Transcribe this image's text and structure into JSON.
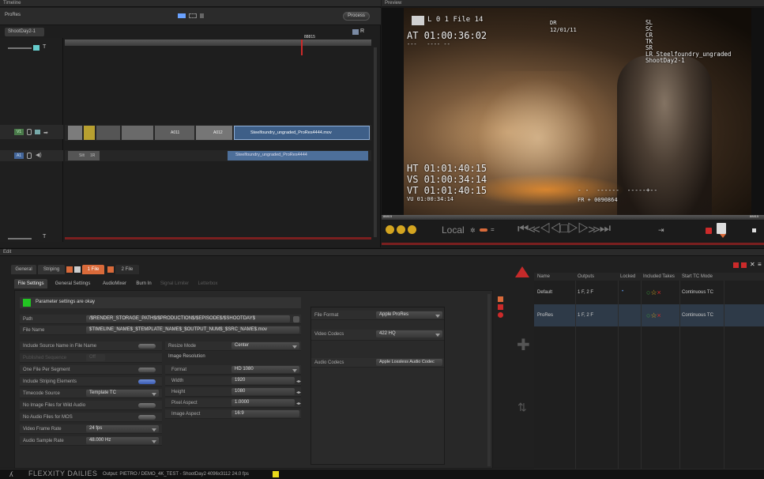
{
  "timeline": {
    "panel_title": "Timeline",
    "project_label": "ProRes",
    "process_button": "Process",
    "sequence_tab": "ShootDay2-1",
    "timecode_marker": "88815",
    "track_video_label": "V1",
    "track_audio_label": "A1",
    "clip_label_1": "A011",
    "clip_label_2": "A012",
    "clip_main": "Steelfoundry_ungraded_ProRes4444.mov",
    "audio_clip": "Steelfoundry_ungraded_ProRes4444",
    "audio_small_1": "Silt",
    "audio_small_2": "1R",
    "track_label_t": "T",
    "track_label_r": "R"
  },
  "preview": {
    "panel_title": "Preview",
    "burn_tl_label": "L 0 1 File 14",
    "burn_at": "AT 01:00:36:02",
    "burn_at_sub": "---   ---- --",
    "burn_dr": "DR",
    "burn_date": "12/01/11",
    "burn_right": "SL\nSC\nCR\nTK\nSR\nLR Steelfoundry_ungraded\nShootDay2-1",
    "burn_ht": "HT 01:01:40:15",
    "burn_vs": "VS 01:00:34:14",
    "burn_vt": "VT 01:01:40:15",
    "burn_vu": "VU 01:00:34:14",
    "burn_dashes": "- -  ------  -----+--",
    "burn_fr": "FR + 0090864",
    "ruler_left": "88815",
    "ruler_right": "88815",
    "local_label": "Local"
  },
  "edit": {
    "panel_title": "Edit",
    "top_tabs": [
      "General",
      "Striping",
      "1 File",
      "2 File"
    ],
    "sub_tabs": [
      "File Settings",
      "General Settings",
      "AudioMixer",
      "Burn In",
      "Signal Limiter",
      "Letterbox"
    ],
    "status_text": "Parameter settings are okay",
    "path_label": "Path",
    "path_value": "/$RENDER_STORAGE_PATH$/$PRODUCTION$/$EPISODE$/$SHOOTDAY$",
    "filename_label": "File Name",
    "filename_value": "$TIMELINE_NAME$_$TEMPLATE_NAME$_$OUTPUT_NUM$_$SRC_NAME$.mov",
    "left_rows": [
      {
        "label": "Include Source Name in File Name",
        "type": "toggle",
        "on": false
      },
      {
        "label": "Published Sequence",
        "type": "text",
        "value": "Off",
        "dim": true
      },
      {
        "label": "One File Per Segment",
        "type": "toggle",
        "on": false
      },
      {
        "label": "Include Striping Elements",
        "type": "toggle",
        "on": true
      },
      {
        "label": "Timecode Source",
        "type": "select",
        "value": "Template TC"
      },
      {
        "label": "No Image Files for Wild Audio",
        "type": "toggle",
        "on": false
      },
      {
        "label": "No Audio Files for MOS",
        "type": "toggle",
        "on": false
      },
      {
        "label": "Video Frame Rate",
        "type": "select",
        "value": "24 fps"
      },
      {
        "label": "Audio Sample Rate",
        "type": "select",
        "value": "48.000 Hz"
      }
    ],
    "resize_label": "Resize Mode",
    "resize_value": "Center",
    "image_res_label": "Image Resolution",
    "mid_rows": [
      {
        "label": "Format",
        "value": "HD 1080",
        "kind": "select"
      },
      {
        "label": "Width",
        "value": "1920",
        "kind": "stepper"
      },
      {
        "label": "Height",
        "value": "1080",
        "kind": "stepper"
      },
      {
        "label": "Pixel Aspect",
        "value": "1.0000",
        "kind": "stepper"
      },
      {
        "label": "Image Aspect",
        "value": "16:9",
        "kind": "text"
      }
    ],
    "file_format_label": "File Format",
    "file_format_value": "Apple ProRes",
    "video_codecs_label": "Video Codecs",
    "video_codecs_value": "422 HQ",
    "audio_codecs_label": "Audio Codecs",
    "audio_codecs_value": "Apple Lossless Audio Codec"
  },
  "outputs_table": {
    "headers": [
      "Name",
      "Outputs",
      "Locked",
      "Included Takes",
      "Start TC Mode"
    ],
    "rows": [
      {
        "name": "Default",
        "outputs": "1 F, 2 F",
        "locked": "•",
        "tc_mode": "Continuous TC"
      },
      {
        "name": "ProRes",
        "outputs": "1 F, 2 F",
        "locked": "",
        "tc_mode": "Continuous TC"
      }
    ]
  },
  "status_bar": {
    "brand": "FLEXXITY  DAILIES",
    "output_text": "Output: PIETRO / DEMO_4K_TEST - ShootDay2   4096x3112   24.0 fps"
  },
  "colors": {
    "accent_red": "#cc2a2a",
    "status_green": "#22c422",
    "clip_blue": "#4d6f9a",
    "toggle_blue": "#4a6bc0",
    "tab_orange": "#d96a3a"
  }
}
